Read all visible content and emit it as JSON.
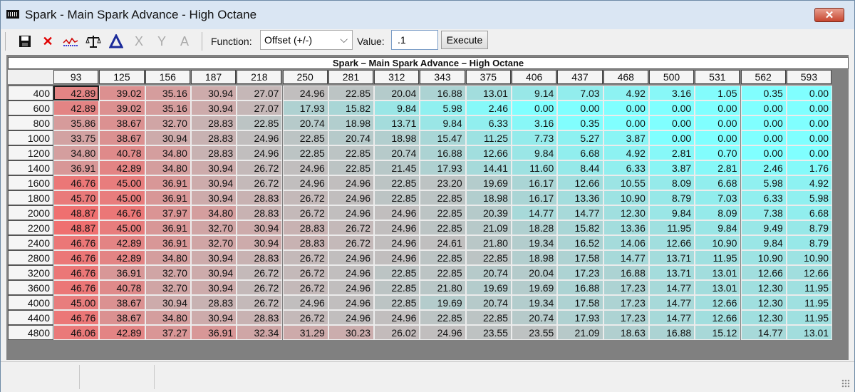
{
  "window": {
    "title": "Spark - Main Spark Advance - High Octane",
    "close_label": "✕"
  },
  "toolbar": {
    "icons": [
      "save-icon",
      "delete-icon",
      "graph-icon",
      "balance-icon",
      "interpolate-icon",
      "x-axis-icon",
      "y-axis-icon",
      "font-icon"
    ],
    "function_label": "Function:",
    "function_value": "Offset (+/-)",
    "value_label": "Value:",
    "value_input": ".1",
    "execute_label": "Execute"
  },
  "table": {
    "title": "Spark – Main Spark Advance – High Octane",
    "columns": [
      "93",
      "125",
      "156",
      "187",
      "218",
      "250",
      "281",
      "312",
      "343",
      "375",
      "406",
      "437",
      "468",
      "500",
      "531",
      "562",
      "593"
    ],
    "rows": [
      "400",
      "600",
      "800",
      "1000",
      "1200",
      "1400",
      "1600",
      "1800",
      "2000",
      "2200",
      "2400",
      "2800",
      "3200",
      "3600",
      "4000",
      "4400",
      "4800"
    ],
    "values": [
      [
        "42.89",
        "39.02",
        "35.16",
        "30.94",
        "27.07",
        "24.96",
        "22.85",
        "20.04",
        "16.88",
        "13.01",
        "9.14",
        "7.03",
        "4.92",
        "3.16",
        "1.05",
        "0.35",
        "0.00"
      ],
      [
        "42.89",
        "39.02",
        "35.16",
        "30.94",
        "27.07",
        "17.93",
        "15.82",
        "9.84",
        "5.98",
        "2.46",
        "0.00",
        "0.00",
        "0.00",
        "0.00",
        "0.00",
        "0.00",
        "0.00"
      ],
      [
        "35.86",
        "38.67",
        "32.70",
        "28.83",
        "22.85",
        "20.74",
        "18.98",
        "13.71",
        "9.84",
        "6.33",
        "3.16",
        "0.35",
        "0.00",
        "0.00",
        "0.00",
        "0.00",
        "0.00"
      ],
      [
        "33.75",
        "38.67",
        "30.94",
        "28.83",
        "24.96",
        "22.85",
        "20.74",
        "18.98",
        "15.47",
        "11.25",
        "7.73",
        "5.27",
        "3.87",
        "0.00",
        "0.00",
        "0.00",
        "0.00"
      ],
      [
        "34.80",
        "40.78",
        "34.80",
        "28.83",
        "24.96",
        "22.85",
        "22.85",
        "20.74",
        "16.88",
        "12.66",
        "9.84",
        "6.68",
        "4.92",
        "2.81",
        "0.70",
        "0.00",
        "0.00"
      ],
      [
        "36.91",
        "42.89",
        "34.80",
        "30.94",
        "26.72",
        "24.96",
        "22.85",
        "21.45",
        "17.93",
        "14.41",
        "11.60",
        "8.44",
        "6.33",
        "3.87",
        "2.81",
        "2.46",
        "1.76"
      ],
      [
        "46.76",
        "45.00",
        "36.91",
        "30.94",
        "26.72",
        "24.96",
        "24.96",
        "22.85",
        "23.20",
        "19.69",
        "16.17",
        "12.66",
        "10.55",
        "8.09",
        "6.68",
        "5.98",
        "4.92"
      ],
      [
        "45.70",
        "45.00",
        "36.91",
        "30.94",
        "28.83",
        "26.72",
        "24.96",
        "22.85",
        "22.85",
        "18.98",
        "16.17",
        "13.36",
        "10.90",
        "8.79",
        "7.03",
        "6.33",
        "5.98"
      ],
      [
        "48.87",
        "46.76",
        "37.97",
        "34.80",
        "28.83",
        "26.72",
        "24.96",
        "24.96",
        "22.85",
        "20.39",
        "14.77",
        "14.77",
        "12.30",
        "9.84",
        "8.09",
        "7.38",
        "6.68"
      ],
      [
        "48.87",
        "45.00",
        "36.91",
        "32.70",
        "30.94",
        "28.83",
        "26.72",
        "24.96",
        "22.85",
        "21.09",
        "18.28",
        "15.82",
        "13.36",
        "11.95",
        "9.84",
        "9.49",
        "8.79"
      ],
      [
        "46.76",
        "42.89",
        "36.91",
        "32.70",
        "30.94",
        "28.83",
        "26.72",
        "24.96",
        "24.61",
        "21.80",
        "19.34",
        "16.52",
        "14.06",
        "12.66",
        "10.90",
        "9.84",
        "8.79"
      ],
      [
        "46.76",
        "42.89",
        "34.80",
        "30.94",
        "28.83",
        "26.72",
        "24.96",
        "24.96",
        "22.85",
        "22.85",
        "18.98",
        "17.58",
        "14.77",
        "13.71",
        "11.95",
        "10.90",
        "10.90"
      ],
      [
        "46.76",
        "36.91",
        "32.70",
        "30.94",
        "26.72",
        "26.72",
        "24.96",
        "22.85",
        "22.85",
        "20.74",
        "20.04",
        "17.23",
        "16.88",
        "13.71",
        "13.01",
        "12.66",
        "12.66"
      ],
      [
        "46.76",
        "40.78",
        "32.70",
        "30.94",
        "26.72",
        "26.72",
        "24.96",
        "22.85",
        "21.80",
        "19.69",
        "19.69",
        "16.88",
        "17.23",
        "14.77",
        "13.01",
        "12.30",
        "11.95"
      ],
      [
        "45.00",
        "38.67",
        "30.94",
        "28.83",
        "26.72",
        "24.96",
        "24.96",
        "22.85",
        "19.69",
        "20.74",
        "19.34",
        "17.58",
        "17.23",
        "14.77",
        "12.66",
        "12.30",
        "11.95"
      ],
      [
        "46.76",
        "38.67",
        "34.80",
        "30.94",
        "28.83",
        "26.72",
        "24.96",
        "24.96",
        "22.85",
        "22.85",
        "20.74",
        "17.93",
        "17.23",
        "14.77",
        "12.66",
        "12.30",
        "11.95"
      ],
      [
        "46.06",
        "42.89",
        "37.27",
        "36.91",
        "32.34",
        "31.29",
        "30.23",
        "26.02",
        "24.96",
        "23.55",
        "23.55",
        "21.09",
        "18.63",
        "16.88",
        "15.12",
        "14.77",
        "13.01"
      ]
    ]
  }
}
